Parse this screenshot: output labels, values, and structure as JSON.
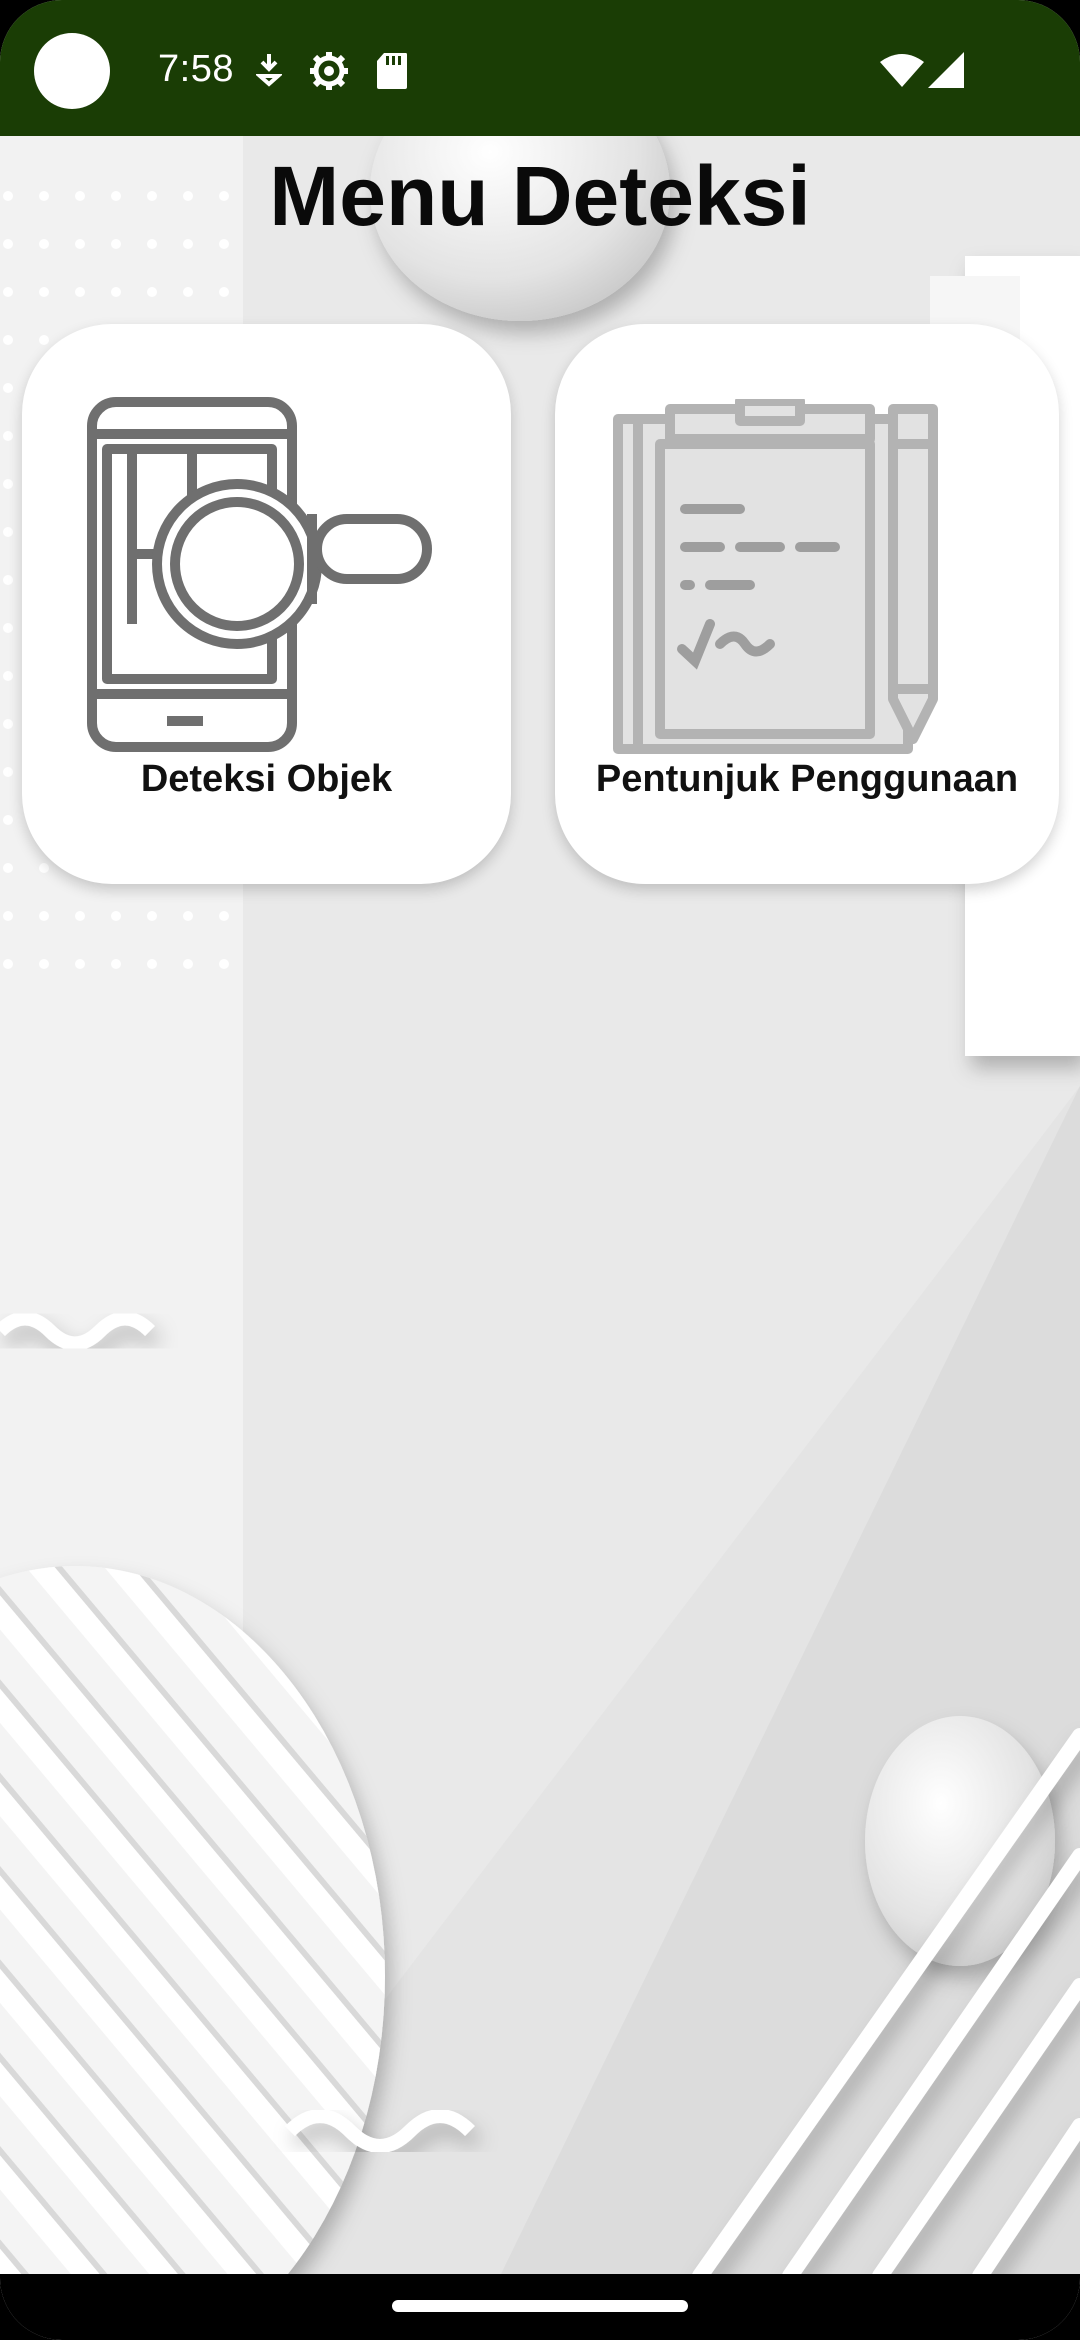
{
  "status_bar": {
    "time": "7:58",
    "left_icons": [
      "recording-dot",
      "download-icon",
      "settings-gear-icon",
      "sd-card-icon"
    ],
    "right_icons": [
      "wifi-icon",
      "signal-icon"
    ],
    "background_color": "#1a3d05"
  },
  "page": {
    "title": "Menu Deteksi"
  },
  "menu": {
    "items": [
      {
        "label": "Deteksi Objek",
        "icon": "phone-magnifier-icon"
      },
      {
        "label": "Pentunjuk Penggunaan",
        "icon": "clipboard-pencil-icon"
      }
    ]
  },
  "colors": {
    "accent": "#1a3d05",
    "card": "#ffffff",
    "background": "#e6e6e6"
  }
}
